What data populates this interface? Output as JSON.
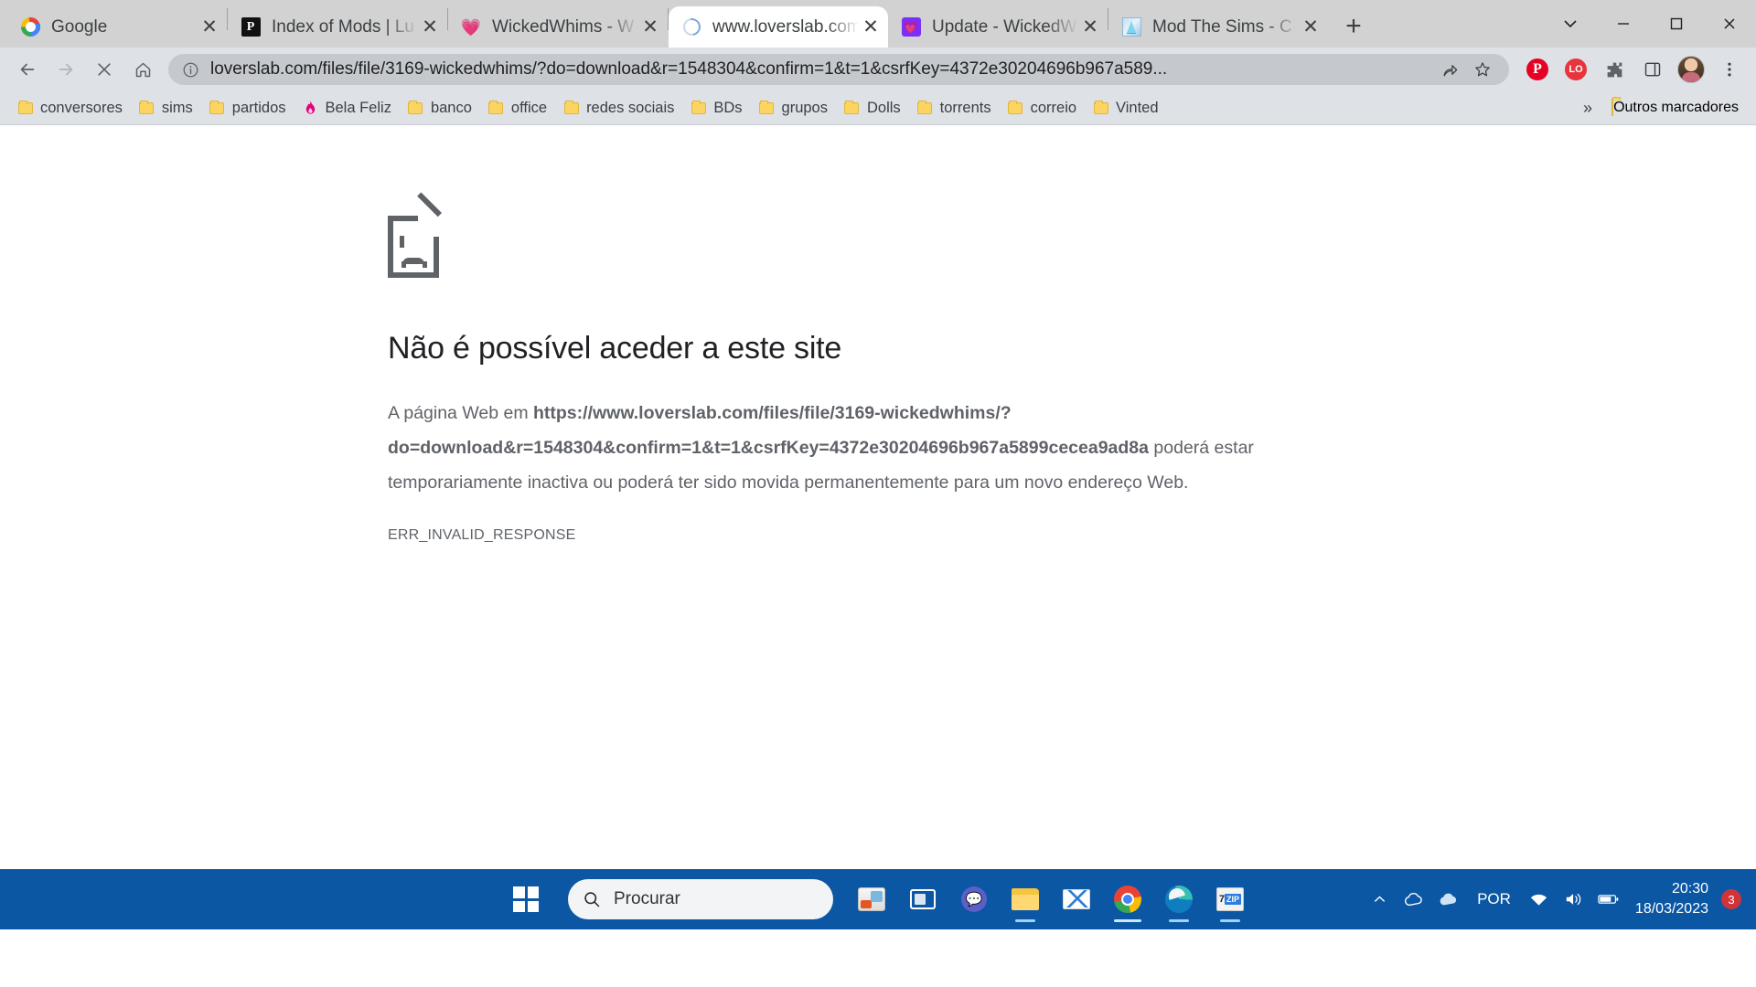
{
  "browser": {
    "tabs": [
      {
        "title": "Google",
        "favicon": "google-icon",
        "active": false
      },
      {
        "title": "Index of Mods | Lu",
        "favicon": "patreon-icon",
        "active": false
      },
      {
        "title": "WickedWhims - W",
        "favicon": "wickedwhims-icon",
        "active": false
      },
      {
        "title": "www.loverslab.com",
        "favicon": "loading-spinner-icon",
        "active": true
      },
      {
        "title": "Update - WickedW",
        "favicon": "loverslab-icon",
        "active": false
      },
      {
        "title": "Mod The Sims - C",
        "favicon": "modthesims-icon",
        "active": false
      }
    ],
    "tab_close_label": "✕",
    "new_tab_label": "+",
    "window_controls": {
      "collapse": "⌄",
      "minimize": "─",
      "maximize": "□",
      "close": "✕"
    },
    "toolbar": {
      "back": "←",
      "forward": "→",
      "stop": "✕",
      "home": "⌂",
      "url": "loverslab.com/files/file/3169-wickedwhims/?do=download&r=1548304&confirm=1&t=1&csrfKey=4372e30204696b967a589...",
      "info_icon": "info-circle-icon",
      "share_icon": "share-icon",
      "bookmark_icon": "star-icon",
      "extensions": [
        {
          "name": "pinterest-extension",
          "glyph": "P"
        },
        {
          "name": "lastpass-extension",
          "glyph": "LO"
        },
        {
          "name": "puzzle-extension",
          "glyph": "🧩"
        },
        {
          "name": "sidepanel-button",
          "glyph": "⬜"
        }
      ],
      "profile_name": "profile-avatar",
      "menu_glyph": "⋮"
    },
    "bookmarks": {
      "items": [
        {
          "label": "conversores",
          "icon": "folder-icon"
        },
        {
          "label": "sims",
          "icon": "folder-icon"
        },
        {
          "label": "partidos",
          "icon": "folder-icon"
        },
        {
          "label": "Bela Feliz",
          "icon": "flame-icon"
        },
        {
          "label": "banco",
          "icon": "folder-icon"
        },
        {
          "label": "office",
          "icon": "folder-icon"
        },
        {
          "label": "redes sociais",
          "icon": "folder-icon"
        },
        {
          "label": "BDs",
          "icon": "folder-icon"
        },
        {
          "label": "grupos",
          "icon": "folder-icon"
        },
        {
          "label": "Dolls",
          "icon": "folder-icon"
        },
        {
          "label": "torrents",
          "icon": "folder-icon"
        },
        {
          "label": "correio",
          "icon": "folder-icon"
        },
        {
          "label": "Vinted",
          "icon": "folder-icon"
        }
      ],
      "overflow_label": "»",
      "other_bookmarks": "Outros marcadores"
    }
  },
  "error_page": {
    "icon": "sad-document-icon",
    "title": "Não é possível aceder a este site",
    "desc_prefix": "A página Web em ",
    "desc_url": "https://www.loverslab.com/files/file/3169-wickedwhims/?do=download&r=1548304&confirm=1&t=1&csrfKey=4372e30204696b967a5899cecea9ad8a",
    "desc_suffix": " poderá estar temporariamente inactiva ou poderá ter sido movida permanentemente para um novo endereço Web.",
    "error_code": "ERR_INVALID_RESPONSE"
  },
  "taskbar": {
    "start_label": "start-button",
    "search_placeholder": "Procurar",
    "search_icon": "search-icon",
    "apps": [
      {
        "name": "paint-3d",
        "running": false
      },
      {
        "name": "task-view",
        "running": false
      },
      {
        "name": "teams",
        "running": false
      },
      {
        "name": "file-explorer",
        "running": true
      },
      {
        "name": "mail",
        "running": false
      },
      {
        "name": "google-chrome",
        "running": true,
        "active": true
      },
      {
        "name": "microsoft-edge",
        "running": true
      },
      {
        "name": "7-zip",
        "running": true
      }
    ],
    "tray": {
      "show_hidden": "∧",
      "onedrive": "☁",
      "cloud": "☁",
      "language": "POR",
      "wifi": "wifi-icon",
      "volume": "volume-icon",
      "battery": "battery-icon",
      "time": "20:30",
      "date": "18/03/2023",
      "notification_count": "3"
    }
  }
}
